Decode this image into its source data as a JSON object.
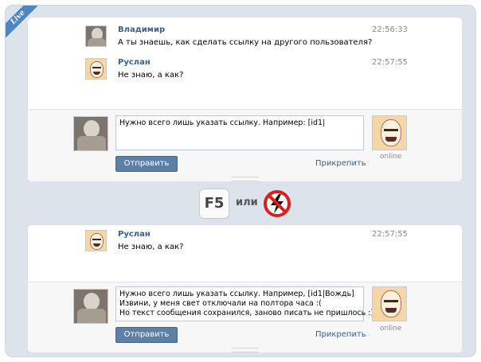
{
  "badge": "Live",
  "conversation_1": {
    "messages": [
      {
        "author": "Владимир",
        "text": "А ты знаешь, как сделать ссылку на другого пользователя?",
        "time": "22:56:33",
        "avatar": "vladimir-avatar"
      },
      {
        "author": "Руслан",
        "text": "Не знаю, а как?",
        "time": "22:57:55",
        "avatar": "ruslan-avatar"
      }
    ],
    "compose": {
      "value": "Нужно всего лишь указать ссылку. Например: [id1|",
      "send_label": "Отправить",
      "attach_label": "Прикрепить",
      "peer_status": "online"
    }
  },
  "separator": {
    "key_label": "F5",
    "or_label": "или",
    "icon": "no-power-icon"
  },
  "conversation_2": {
    "messages": [
      {
        "author": "Руслан",
        "text": "Не знаю, а как?",
        "time": "22:57:55",
        "avatar": "ruslan-avatar"
      }
    ],
    "compose": {
      "value": "Нужно всего лишь указать ссылку. Например, [id1|Вождь]\nИзвини, у меня свет отключали на полтора часа :(\nНо текст сообщения сохранился, заново писать не пришлось :)",
      "send_label": "Отправить",
      "attach_label": "Прикрепить",
      "peer_status": "online"
    }
  },
  "colors": {
    "link": "#3b5f8d",
    "button": "#5d7fa6",
    "frame": "#dde3ea",
    "badge": "#4d86c4",
    "no_power_red": "#d8201c"
  }
}
